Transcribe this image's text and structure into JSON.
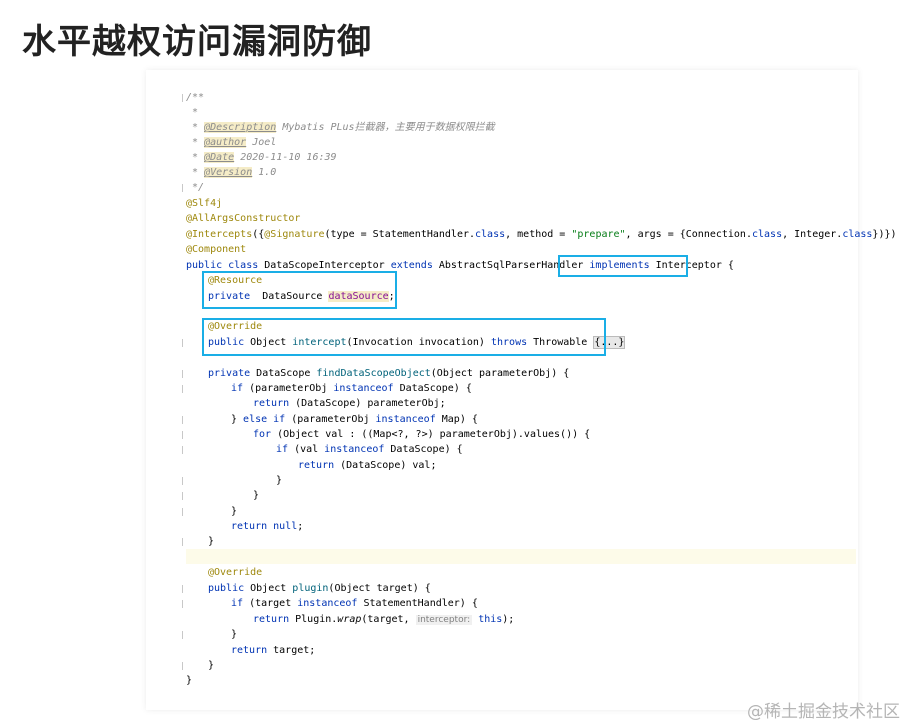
{
  "page": {
    "title": "水平越权访问漏洞防御",
    "watermark": "@稀土掘金技术社区"
  },
  "code": {
    "l1": "/**",
    "l2": " *",
    "l3_pre": " * ",
    "l3_tag": "@Description",
    "l3_text": " Mybatis PLus拦截器，主要用于数据权限拦截",
    "l4_pre": " * ",
    "l4_tag": "@author",
    "l4_text": " Joel",
    "l5_pre": " * ",
    "l5_tag": "@Date",
    "l5_text": " 2020-11-10 16:39",
    "l6_pre": " * ",
    "l6_tag": "@Version",
    "l6_text": " 1.0",
    "l7": " */",
    "l8": "@Slf4j",
    "l9": "@AllArgsConstructor",
    "l10_a": "@Intercepts",
    "l10_b": "({",
    "l10_c": "@Signature",
    "l10_d": "(type = StatementHandler.",
    "l10_e": "class",
    "l10_f": ", method = ",
    "l10_g": "\"prepare\"",
    "l10_h": ", args = {Connection.",
    "l10_i": "class",
    "l10_j": ", Integer.",
    "l10_k": "class",
    "l10_l": "})})",
    "l11": "@Component",
    "l12_a": "public class",
    "l12_b": " DataScopeInterceptor ",
    "l12_c": "extends",
    "l12_d": " AbstractSqlParserHandler ",
    "l12_e": "implements",
    "l12_f": " Interceptor",
    "l12_g": " {",
    "l13": "@Resource",
    "l14_a": "private",
    "l14_b": "  DataSource ",
    "l14_c": "dataSource",
    "l14_d": ";",
    "l16": "@Override",
    "l17_a": "public",
    "l17_b": " Object ",
    "l17_c": "intercept",
    "l17_d": "(Invocation invocation) ",
    "l17_e": "throws",
    "l17_f": " Throwable ",
    "l17_g": "{...}",
    "l19_a": "private",
    "l19_b": " DataScope ",
    "l19_c": "findDataScopeObject",
    "l19_d": "(Object parameterObj) {",
    "l20_a": "if",
    "l20_b": " (parameterObj ",
    "l20_c": "instanceof",
    "l20_d": " DataScope) {",
    "l21_a": "return",
    "l21_b": " (DataScope) parameterObj;",
    "l22_a": "} ",
    "l22_b": "else if",
    "l22_c": " (parameterObj ",
    "l22_d": "instanceof",
    "l22_e": " Map) {",
    "l23_a": "for",
    "l23_b": " (Object val : ((Map<?, ?>) parameterObj).values()) {",
    "l24_a": "if",
    "l24_b": " (val ",
    "l24_c": "instanceof",
    "l24_d": " DataScope) {",
    "l25_a": "return",
    "l25_b": " (DataScope) val;",
    "l26": "}",
    "l27": "}",
    "l28": "}",
    "l29_a": "return",
    "l29_b": " null",
    "l29_c": ";",
    "l30": "}",
    "l32": "@Override",
    "l33_a": "public",
    "l33_b": " Object ",
    "l33_c": "plugin",
    "l33_d": "(Object target) {",
    "l34_a": "if",
    "l34_b": " (target ",
    "l34_c": "instanceof",
    "l34_d": " StatementHandler) {",
    "l35_a": "return",
    "l35_b": " Plugin.",
    "l35_c": "wrap",
    "l35_d": "(target, ",
    "l35_e": "interceptor:",
    "l35_f": " this",
    "l35_g": ");",
    "l36": "}",
    "l37_a": "return",
    "l37_b": " target;",
    "l38": "}",
    "l39": "}"
  },
  "colors": {
    "highlight_box": "#1aaee6",
    "keyword": "#0033b3",
    "annotation": "#9e880d",
    "string": "#067d17",
    "field": "#871094"
  }
}
